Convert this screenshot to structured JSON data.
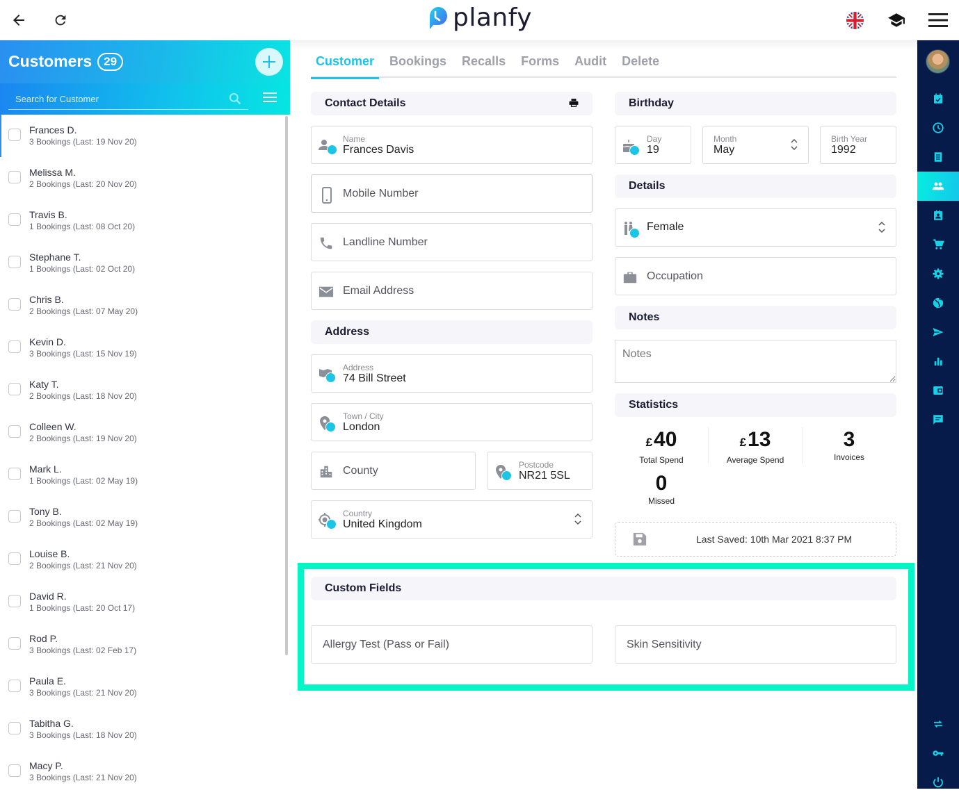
{
  "topbar": {
    "brand": "planfy",
    "back_icon": "arrow-left-icon",
    "refresh_icon": "refresh-icon",
    "language_icon": "uk-flag-icon",
    "help_icon": "graduation-cap-icon",
    "menu_icon": "hamburger-menu-icon"
  },
  "customers": {
    "title": "Customers",
    "count": "29",
    "search_placeholder": "Search for Customer",
    "list": [
      {
        "name": "Frances D.",
        "sub": "3 Bookings (Last: 19 Nov 20)",
        "active": true
      },
      {
        "name": "Melissa M.",
        "sub": "2 Bookings (Last: 20 Nov 20)"
      },
      {
        "name": "Travis B.",
        "sub": "1 Bookings (Last: 08 Oct 20)"
      },
      {
        "name": "Stephane T.",
        "sub": "1 Bookings (Last: 02 Oct 20)"
      },
      {
        "name": "Chris B.",
        "sub": "2 Bookings (Last: 07 May 20)"
      },
      {
        "name": "Kevin D.",
        "sub": "3 Bookings (Last: 15 Nov 19)"
      },
      {
        "name": "Katy T.",
        "sub": "2 Bookings (Last: 18 Nov 20)"
      },
      {
        "name": "Colleen W.",
        "sub": "2 Bookings (Last: 19 Nov 20)"
      },
      {
        "name": "Mark L.",
        "sub": "1 Bookings (Last: 02 May 19)"
      },
      {
        "name": "Tony B.",
        "sub": "2 Bookings (Last: 02 May 19)"
      },
      {
        "name": "Louise B.",
        "sub": "2 Bookings (Last: 21 Nov 20)"
      },
      {
        "name": "David R.",
        "sub": "1 Bookings (Last: 20 Oct 17)"
      },
      {
        "name": "Rod P.",
        "sub": "3 Bookings (Last: 02 Feb 17)"
      },
      {
        "name": "Paula E.",
        "sub": "3 Bookings (Last: 21 Nov 20)"
      },
      {
        "name": "Tabitha G.",
        "sub": "3 Bookings (Last: 18 Nov 20)"
      },
      {
        "name": "Macy P.",
        "sub": "3 Bookings (Last: 21 Nov 20)"
      }
    ]
  },
  "tabs": [
    {
      "label": "Customer",
      "active": true
    },
    {
      "label": "Bookings"
    },
    {
      "label": "Recalls"
    },
    {
      "label": "Forms"
    },
    {
      "label": "Audit"
    },
    {
      "label": "Delete"
    }
  ],
  "contact": {
    "heading": "Contact Details",
    "name_label": "Name",
    "name_value": "Frances Davis",
    "mobile_placeholder": "Mobile Number",
    "landline_placeholder": "Landline Number",
    "email_placeholder": "Email Address"
  },
  "address": {
    "heading": "Address",
    "address_label": "Address",
    "address_value": "74 Bill Street",
    "town_label": "Town / City",
    "town_value": "London",
    "county_placeholder": "County",
    "postcode_label": "Postcode",
    "postcode_value": "NR21 5SL",
    "country_label": "Country",
    "country_value": "United Kingdom"
  },
  "birthday": {
    "heading": "Birthday",
    "day_label": "Day",
    "day_value": "19",
    "month_label": "Month",
    "month_value": "May",
    "year_label": "Birth Year",
    "year_value": "1992"
  },
  "details": {
    "heading": "Details",
    "gender_value": "Female",
    "occupation_placeholder": "Occupation"
  },
  "notes": {
    "heading": "Notes",
    "placeholder": "Notes"
  },
  "statistics": {
    "heading": "Statistics",
    "currency": "£",
    "total_spend_value": "40",
    "total_spend_label": "Total Spend",
    "average_spend_value": "13",
    "average_spend_label": "Average Spend",
    "invoices_value": "3",
    "invoices_label": "Invoices",
    "missed_value": "0",
    "missed_label": "Missed",
    "last_saved": "Last Saved: 10th Mar 2021 8:37 PM"
  },
  "custom_fields": {
    "heading": "Custom Fields",
    "field1_placeholder": "Allergy Test (Pass or Fail)",
    "field2_placeholder": "Skin Sensitivity"
  },
  "colors": {
    "accent": "#1cc4e6",
    "nav_bg": "#061b4a",
    "highlight": "#06f5c7"
  },
  "nav": [
    {
      "icon": "calendar-check-icon",
      "active": false
    },
    {
      "icon": "clock-icon",
      "active": false
    },
    {
      "icon": "receipt-icon",
      "active": false
    },
    {
      "icon": "customers-icon",
      "active": true
    },
    {
      "icon": "staff-badge-icon",
      "active": false
    },
    {
      "icon": "cart-icon",
      "active": false
    },
    {
      "icon": "settings-icon",
      "active": false
    },
    {
      "icon": "globe-icon",
      "active": false
    },
    {
      "icon": "send-icon",
      "active": false
    },
    {
      "icon": "bar-chart-icon",
      "active": false
    },
    {
      "icon": "wallet-icon",
      "active": false
    },
    {
      "icon": "message-icon",
      "active": false
    },
    {
      "icon": "swap-icon",
      "active": false
    },
    {
      "icon": "key-icon",
      "active": false
    },
    {
      "icon": "power-icon",
      "active": false
    }
  ]
}
